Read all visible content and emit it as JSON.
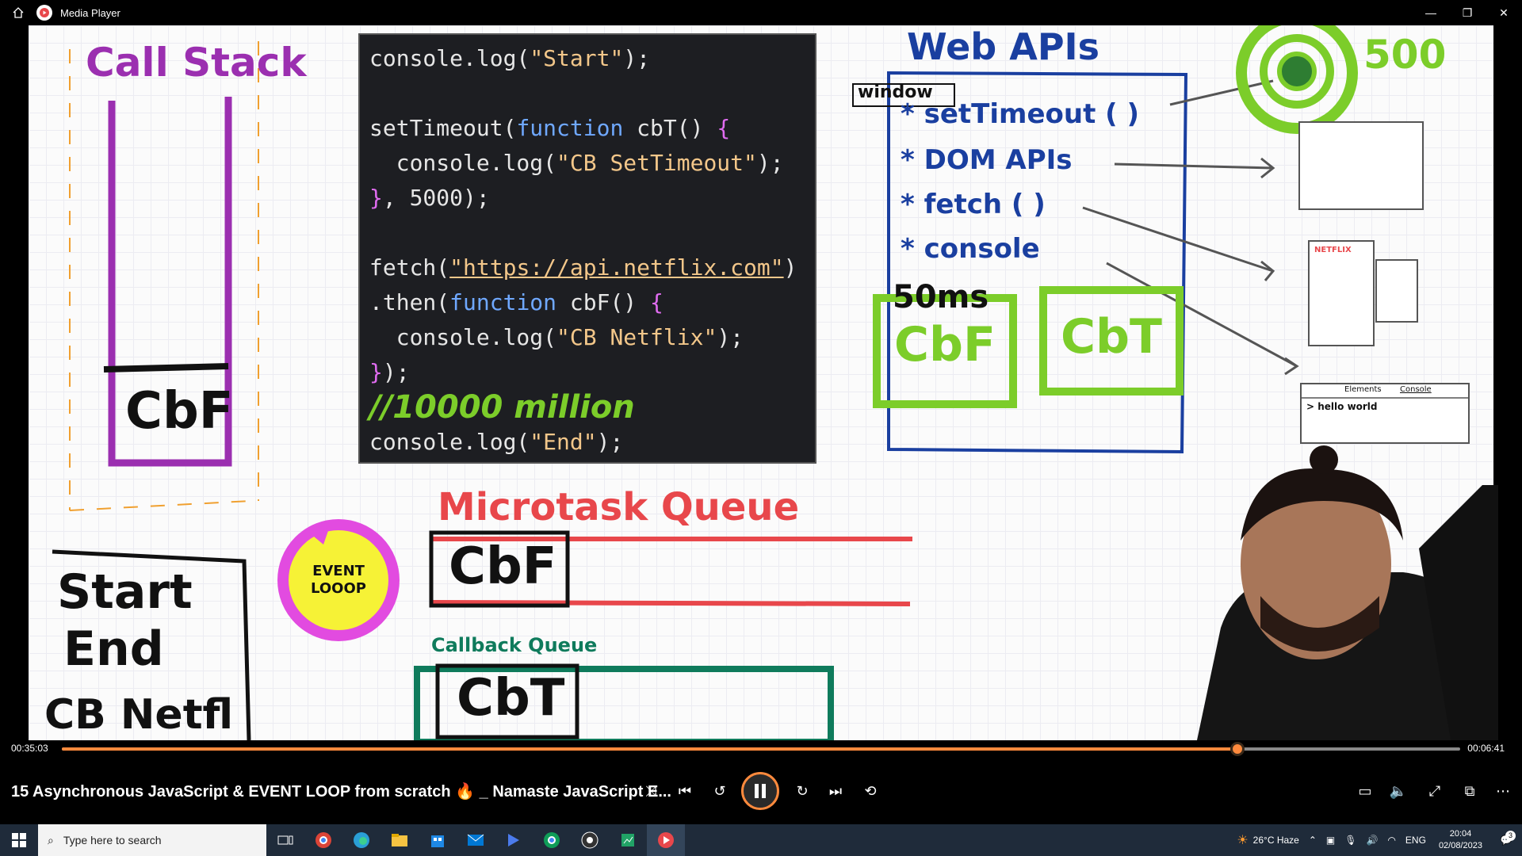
{
  "window": {
    "app_title": "Media Player",
    "controls": [
      "minimize",
      "restore",
      "close"
    ]
  },
  "whiteboard": {
    "call_stack": {
      "title": "Call Stack",
      "frame_label": "CbF"
    },
    "code": {
      "lines": [
        "console.log(\"Start\");",
        "",
        "setTimeout(function cbT() {",
        "  console.log(\"CB SetTimeout\");",
        "}, 5000);",
        "",
        "fetch(\"https://api.netflix.com\")",
        ".then(function cbF() {",
        "  console.log(\"CB Netflix\");",
        "});",
        "//10000 million",
        "console.log(\"End\");"
      ],
      "hand_comment": "//10000 million"
    },
    "web_apis": {
      "title": "Web APIs",
      "window_label": "window",
      "items": [
        "* setTimeout ( )",
        "* DOM APIs",
        "* fetch ( )",
        "* console"
      ],
      "timer_label": "50ms",
      "box1": "CbF",
      "box2": "CbT",
      "timer_number": "500"
    },
    "devtools_sketch": {
      "tabs": [
        "Elements",
        "Console"
      ],
      "line": "> hello world"
    },
    "netflix_label": "NETFLIX",
    "event_loop": "EVENT LOOOP",
    "microtask_queue": {
      "title": "Microtask Queue",
      "item": "CbF"
    },
    "callback_queue": {
      "title": "Callback Queue",
      "item": "CbT"
    },
    "console_output": [
      "Start",
      "End",
      "CB Netfl"
    ]
  },
  "player": {
    "current_time": "00:35:03",
    "remaining_time": "00:06:41",
    "progress": 0.8405,
    "video_title": "15 Asynchronous JavaScript & EVENT LOOP from scratch 🔥 _ Namaste JavaScript E...",
    "buttons": [
      "shuffle",
      "previous",
      "rewind-10",
      "pause",
      "forward-30",
      "next",
      "repeat-off"
    ],
    "right_buttons": [
      "subtitles",
      "volume",
      "fullscreen",
      "mini-view",
      "more"
    ]
  },
  "taskbar": {
    "search_placeholder": "Type here to search",
    "weather": "26°C  Haze",
    "language": "ENG",
    "time": "20:04",
    "date": "02/08/2023",
    "notifications": "3"
  },
  "colors": {
    "accent": "#ff8a3d",
    "purple": "#9b2fb0",
    "green": "#7ccd2a",
    "red": "#e8474b",
    "teal": "#0f7b5c",
    "blue": "#1a3fa0"
  }
}
